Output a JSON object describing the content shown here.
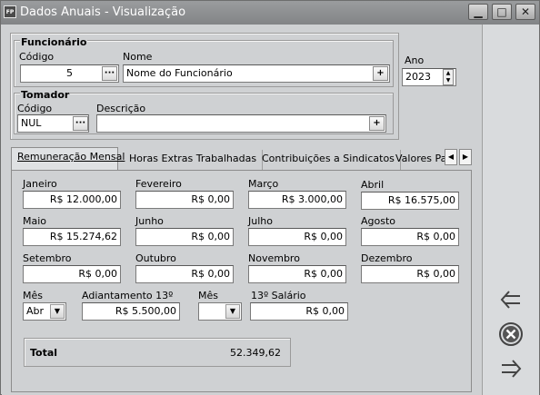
{
  "window": {
    "title": "Dados Anuais - Visualização",
    "icon_text": "FP",
    "buttons": [
      "minimize",
      "maximize",
      "close"
    ]
  },
  "funcionario": {
    "group_title": "Funcionário",
    "codigo_label": "Código",
    "codigo_value": "5",
    "nome_label": "Nome",
    "nome_value": "Nome do Funcionário"
  },
  "ano": {
    "label": "Ano",
    "value": "2023"
  },
  "tomador": {
    "group_title": "Tomador",
    "codigo_label": "Código",
    "codigo_value": "NUL",
    "descricao_label": "Descrição",
    "descricao_value": ""
  },
  "tabs": [
    {
      "label": "Remuneração Mensal",
      "active": true
    },
    {
      "label": "Horas Extras Trabalhadas",
      "active": false
    },
    {
      "label": "Contribuições a Sindicatos",
      "active": false
    },
    {
      "label": "Valores Pag",
      "active": false
    }
  ],
  "months": [
    {
      "label": "Janeiro",
      "value": "R$ 12.000,00"
    },
    {
      "label": "Fevereiro",
      "value": "R$ 0,00"
    },
    {
      "label": "Março",
      "value": "R$ 3.000,00"
    },
    {
      "label": "Abril",
      "value": "R$ 16.575,00"
    },
    {
      "label": "Maio",
      "value": "R$ 15.274,62"
    },
    {
      "label": "Junho",
      "value": "R$ 0,00"
    },
    {
      "label": "Julho",
      "value": "R$ 0,00"
    },
    {
      "label": "Agosto",
      "value": "R$ 0,00"
    },
    {
      "label": "Setembro",
      "value": "R$ 0,00"
    },
    {
      "label": "Outubro",
      "value": "R$ 0,00"
    },
    {
      "label": "Novembro",
      "value": "R$ 0,00"
    },
    {
      "label": "Dezembro",
      "value": "R$ 0,00"
    }
  ],
  "extras": {
    "mes1_label": "Mês",
    "mes1_value": "Abr",
    "adiant_label": "Adiantamento 13º",
    "adiant_value": "R$ 5.500,00",
    "mes2_label": "Mês",
    "mes2_value": "",
    "salario13_label": "13º Salário",
    "salario13_value": "R$ 0,00"
  },
  "total": {
    "label": "Total",
    "value": "52.349,62"
  },
  "side_actions": [
    "back-arrow-icon",
    "cancel-icon",
    "forward-arrow-icon"
  ]
}
